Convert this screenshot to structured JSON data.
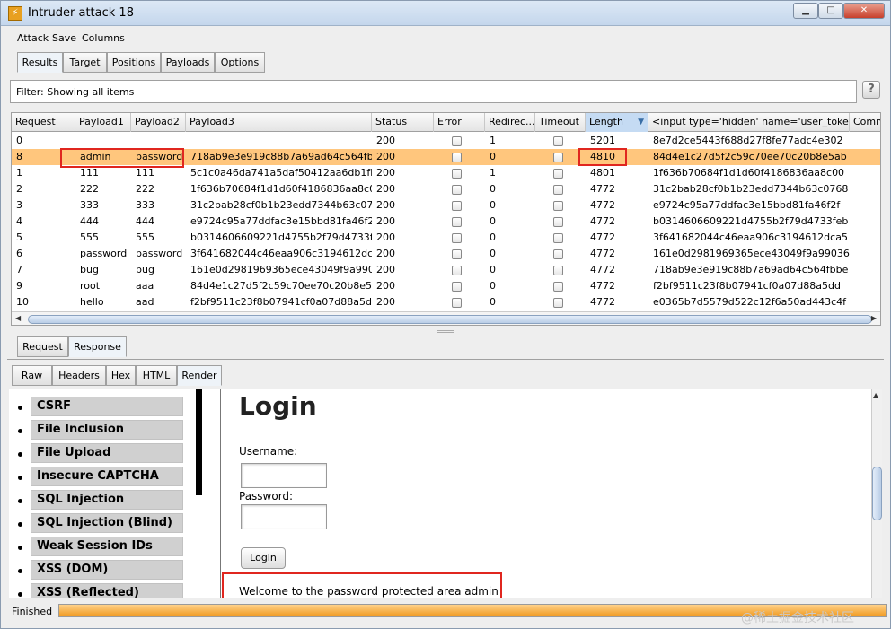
{
  "window": {
    "title": "Intruder attack 18",
    "minimize": "▁",
    "maximize": "□",
    "close": "✕"
  },
  "menu": [
    "Attack",
    "Save",
    "Columns"
  ],
  "top_tabs": [
    "Results",
    "Target",
    "Positions",
    "Payloads",
    "Options"
  ],
  "filter": {
    "text": "Filter:  Showing all items",
    "help": "?"
  },
  "table": {
    "columns": [
      "Request",
      "Payload1",
      "Payload2",
      "Payload3",
      "Status",
      "Error",
      "Redirec...",
      "Timeout",
      "Length",
      "<input type='hidden' name='user_token' val...",
      "Comme"
    ],
    "sort_indicator": "▼",
    "rows": [
      {
        "request": "0",
        "p1": "",
        "p2": "",
        "p3": "",
        "status": "200",
        "redirect": "1",
        "length": "5201",
        "token": "8e7d2ce5443f688d27f8fe77adc4e302"
      },
      {
        "request": "8",
        "p1": "admin",
        "p2": "password",
        "p3": "718ab9e3e919c88b7a69ad64c564fbbe",
        "status": "200",
        "redirect": "0",
        "length": "4810",
        "token": "84d4e1c27d5f2c59c70ee70c20b8e5ab"
      },
      {
        "request": "1",
        "p1": "111",
        "p2": "111",
        "p3": "5c1c0a46da741a5daf50412aa6db1fb5",
        "status": "200",
        "redirect": "1",
        "length": "4801",
        "token": "1f636b70684f1d1d60f4186836aa8c00"
      },
      {
        "request": "2",
        "p1": "222",
        "p2": "222",
        "p3": "1f636b70684f1d1d60f4186836aa8c00",
        "status": "200",
        "redirect": "0",
        "length": "4772",
        "token": "31c2bab28cf0b1b23edd7344b63c0768"
      },
      {
        "request": "3",
        "p1": "333",
        "p2": "333",
        "p3": "31c2bab28cf0b1b23edd7344b63c0768",
        "status": "200",
        "redirect": "0",
        "length": "4772",
        "token": "e9724c95a77ddfac3e15bbd81fa46f2f"
      },
      {
        "request": "4",
        "p1": "444",
        "p2": "444",
        "p3": "e9724c95a77ddfac3e15bbd81fa46f2f",
        "status": "200",
        "redirect": "0",
        "length": "4772",
        "token": "b0314606609221d4755b2f79d4733feb"
      },
      {
        "request": "5",
        "p1": "555",
        "p2": "555",
        "p3": "b0314606609221d4755b2f79d4733feb",
        "status": "200",
        "redirect": "0",
        "length": "4772",
        "token": "3f641682044c46eaa906c3194612dca5"
      },
      {
        "request": "6",
        "p1": "password",
        "p2": "password",
        "p3": "3f641682044c46eaa906c3194612dca5",
        "status": "200",
        "redirect": "0",
        "length": "4772",
        "token": "161e0d2981969365ece43049f9a99036"
      },
      {
        "request": "7",
        "p1": "bug",
        "p2": "bug",
        "p3": "161e0d2981969365ece43049f9a99036",
        "status": "200",
        "redirect": "0",
        "length": "4772",
        "token": "718ab9e3e919c88b7a69ad64c564fbbe"
      },
      {
        "request": "9",
        "p1": "root",
        "p2": "aaa",
        "p3": "84d4e1c27d5f2c59c70ee70c20b8e5ab",
        "status": "200",
        "redirect": "0",
        "length": "4772",
        "token": "f2bf9511c23f8b07941cf0a07d88a5dd"
      },
      {
        "request": "10",
        "p1": "hello",
        "p2": "aad",
        "p3": "f2bf9511c23f8b07941cf0a07d88a5dd",
        "status": "200",
        "redirect": "0",
        "length": "4772",
        "token": "e0365b7d5579d522c12f6a50ad443c4f"
      }
    ],
    "selected_row": 1
  },
  "req_tabs": [
    "Request",
    "Response"
  ],
  "resp_tabs": [
    "Raw",
    "Headers",
    "Hex",
    "HTML",
    "Render"
  ],
  "render": {
    "menu_items": [
      "CSRF",
      "File Inclusion",
      "File Upload",
      "Insecure CAPTCHA",
      "SQL Injection",
      "SQL Injection (Blind)",
      "Weak Session IDs",
      "XSS (DOM)",
      "XSS (Reflected)"
    ],
    "login_title": "Login",
    "username_label": "Username:",
    "password_label": "Password:",
    "login_button": "Login",
    "welcome": "Welcome to the password protected area admin"
  },
  "status": {
    "text": "Finished",
    "progress": 1.0
  },
  "watermark": "@稀土掘金技术社区",
  "colors": {
    "selected_row": "#ffc67d",
    "highlight_box": "#e0261f",
    "progress": "#f09a20"
  }
}
